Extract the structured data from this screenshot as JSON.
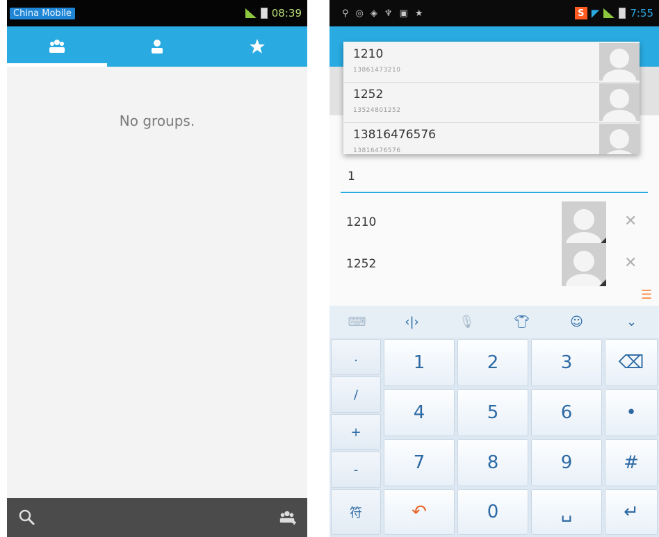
{
  "left_screen": {
    "status_bar": {
      "carrier": "China Mobile",
      "time": "08:39"
    },
    "tabs": [
      {
        "icon": "groups-icon",
        "active": true
      },
      {
        "icon": "contact-icon",
        "active": false
      },
      {
        "icon": "star-icon",
        "active": false
      }
    ],
    "empty_message": "No groups.",
    "bottom_bar": {
      "left_icon": "search-icon",
      "right_icon": "add-group-icon"
    }
  },
  "right_screen": {
    "status_bar": {
      "time": "7:55"
    },
    "suggestions": [
      {
        "name": "1210",
        "number": "13861473210"
      },
      {
        "name": "1252",
        "number": "13524801252"
      },
      {
        "name": "13816476576",
        "number": "13816476576"
      }
    ],
    "input_value": "1",
    "recipients": [
      {
        "name": "1210"
      },
      {
        "name": "1252"
      }
    ],
    "keyboard": {
      "side_keys": [
        ".",
        "/",
        "+",
        "-",
        "符"
      ],
      "digits": [
        "1",
        "2",
        "3",
        "4",
        "5",
        "6",
        "7",
        "8",
        "9",
        "0"
      ],
      "right_keys": [
        "⌫",
        "•",
        "#",
        "↵"
      ],
      "space_label": "␣"
    },
    "colors": {
      "accent": "#29abe2",
      "key_text": "#2d6aa3",
      "undo": "#e8642a"
    }
  }
}
